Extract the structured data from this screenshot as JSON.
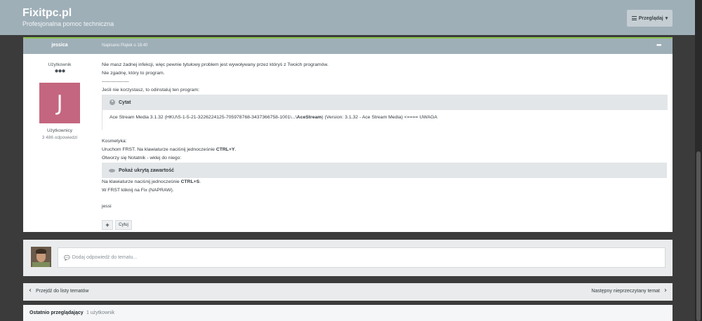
{
  "site": {
    "title": "Fixitpc.pl",
    "subtitle": "Profesjonalna pomoc techniczna"
  },
  "header": {
    "browse_label": "Przeglądaj",
    "browse_caret": "▾"
  },
  "post": {
    "author": "jessica",
    "date": "Napisano Piątek o 18:40",
    "menu": "•••",
    "role": "Użytkownik",
    "pips": "●●●",
    "avatar_letter": "J",
    "avatar_color": "#c4667f",
    "group": "Użytkownicy",
    "count": "3 486 odpowiedzi",
    "lines": {
      "l1": "Nie masz żadnej infekcji, więc pewnie tytułowy problem jest wywoływany przez któryś z Twoich programów.",
      "l2": "Nie zgadnę, który to program.",
      "l3": "-----------------",
      "l4": "Jeśli nie korzystasz, to odinstaluj ten program:"
    },
    "quote": {
      "label": "Cytat",
      "pre": "Ace Stream Media 3.1.32 (HKU\\S-1-5-21-3226224125-705978768-3437366758-1001\\...\\",
      "bold": "AceStream",
      "post": ") (Version: 3.1.32 - Ace Stream Media) <==== UWAGA"
    },
    "cosm": {
      "l1": "Kosmetyka:",
      "l2_pre": "Uruchom FRST. Na klawiaturze naciśnij jednocześnie ",
      "l2_bold": "CTRL+Y",
      "l2_post": ".",
      "l3": "Otworzy się Notatnik - wklej do niego:"
    },
    "spoiler_label": "Pokaż ukrytą zawartość",
    "after": {
      "l1_pre": "Na klawiaturze naciśnij jednocześnie ",
      "l1_bold": "CTRL+S",
      "l1_post": ".",
      "l2": "W FRST kliknij na Fix (NAPRAW).",
      "sign": "jessi"
    },
    "plus_label": "+",
    "quote_button": "Cytuj"
  },
  "reply": {
    "placeholder": "Dodaj odpowiedź do tematu..."
  },
  "nav": {
    "prev": "Przejdź do listy tematów",
    "next": "Następny nieprzeczytany temat"
  },
  "recent": {
    "title": "Ostatnio przeglądający",
    "count": "1 użytkownik"
  }
}
